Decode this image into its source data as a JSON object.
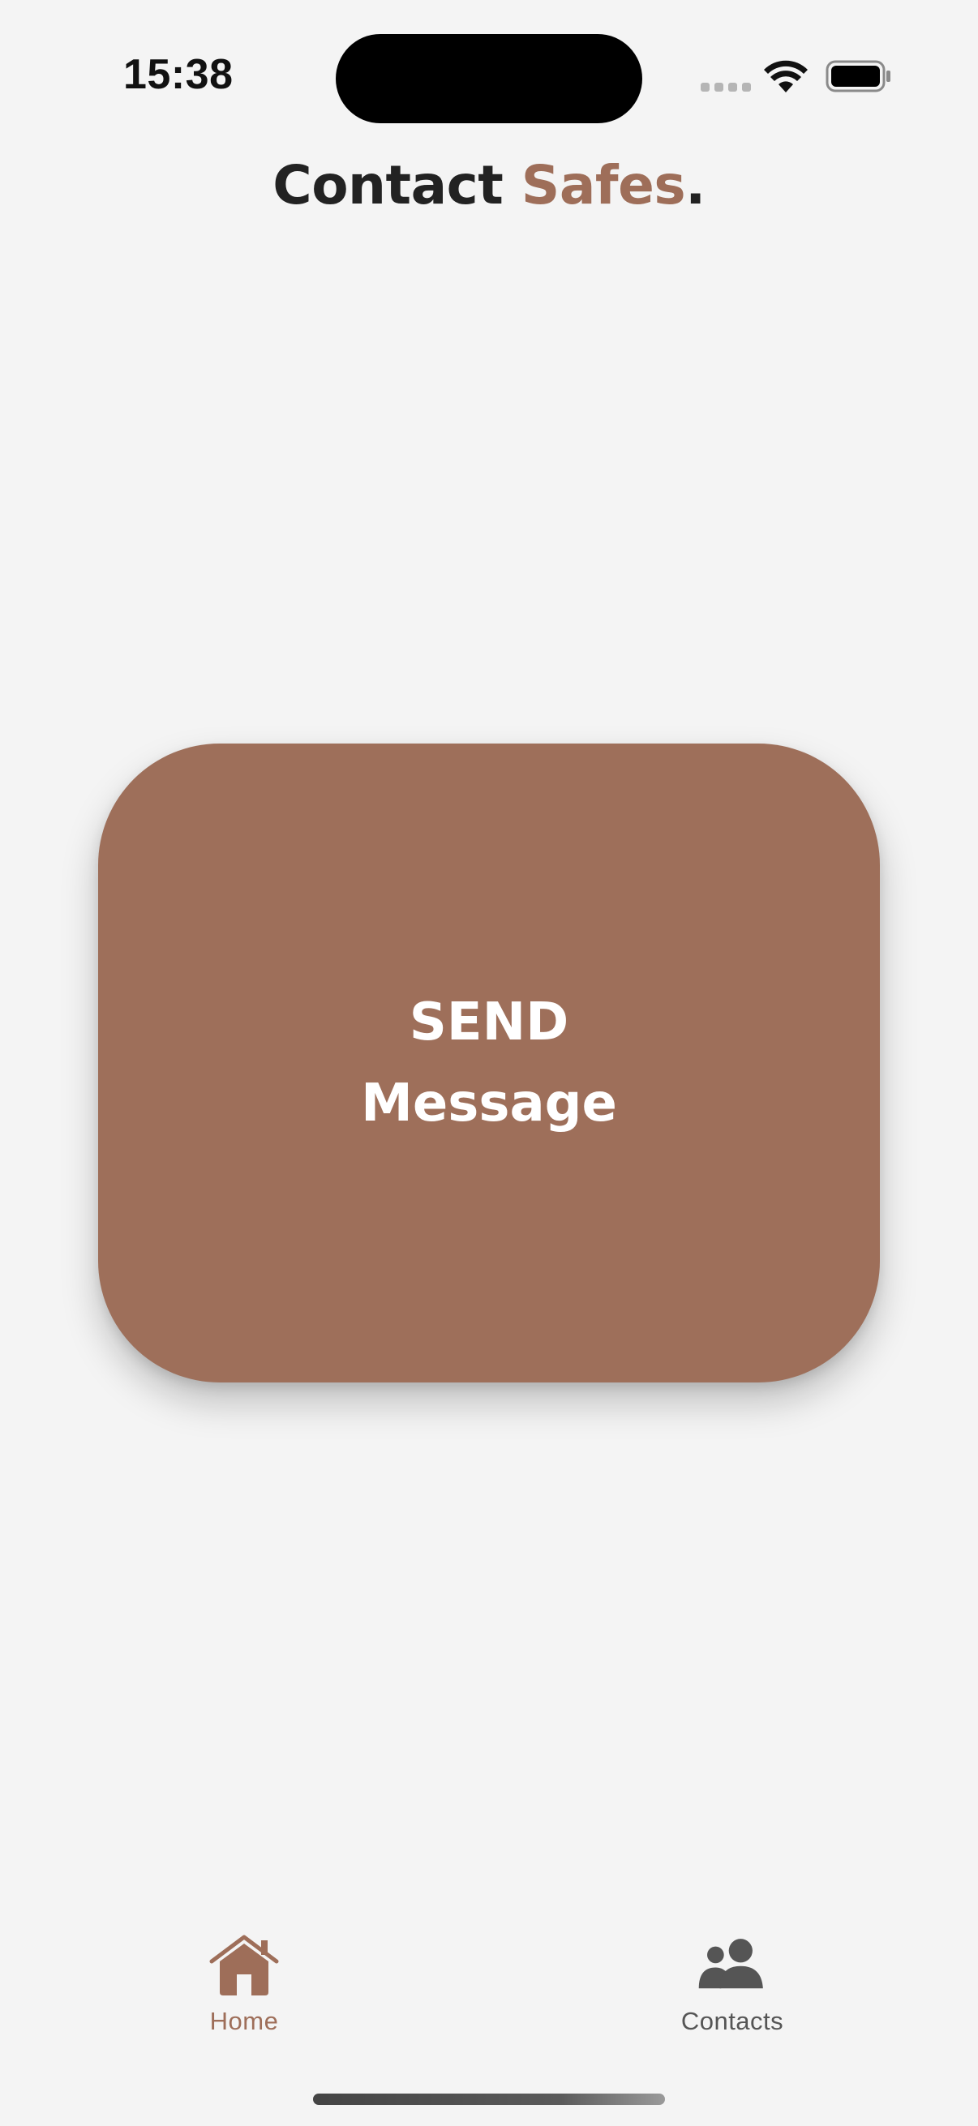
{
  "status_bar": {
    "time": "15:38"
  },
  "header": {
    "title_main": "Contact ",
    "title_accent": "Safes",
    "title_suffix": "."
  },
  "main": {
    "send_button": {
      "line1": "SEND",
      "line2": "Message"
    }
  },
  "tab_bar": {
    "tabs": [
      {
        "label": "Home",
        "icon": "home-icon",
        "active": true
      },
      {
        "label": "Contacts",
        "icon": "contacts-icon",
        "active": false
      }
    ]
  },
  "colors": {
    "accent": "#9e6f5a",
    "background": "#f4f4f4",
    "title_text": "#222222",
    "inactive_tab": "#555555"
  }
}
